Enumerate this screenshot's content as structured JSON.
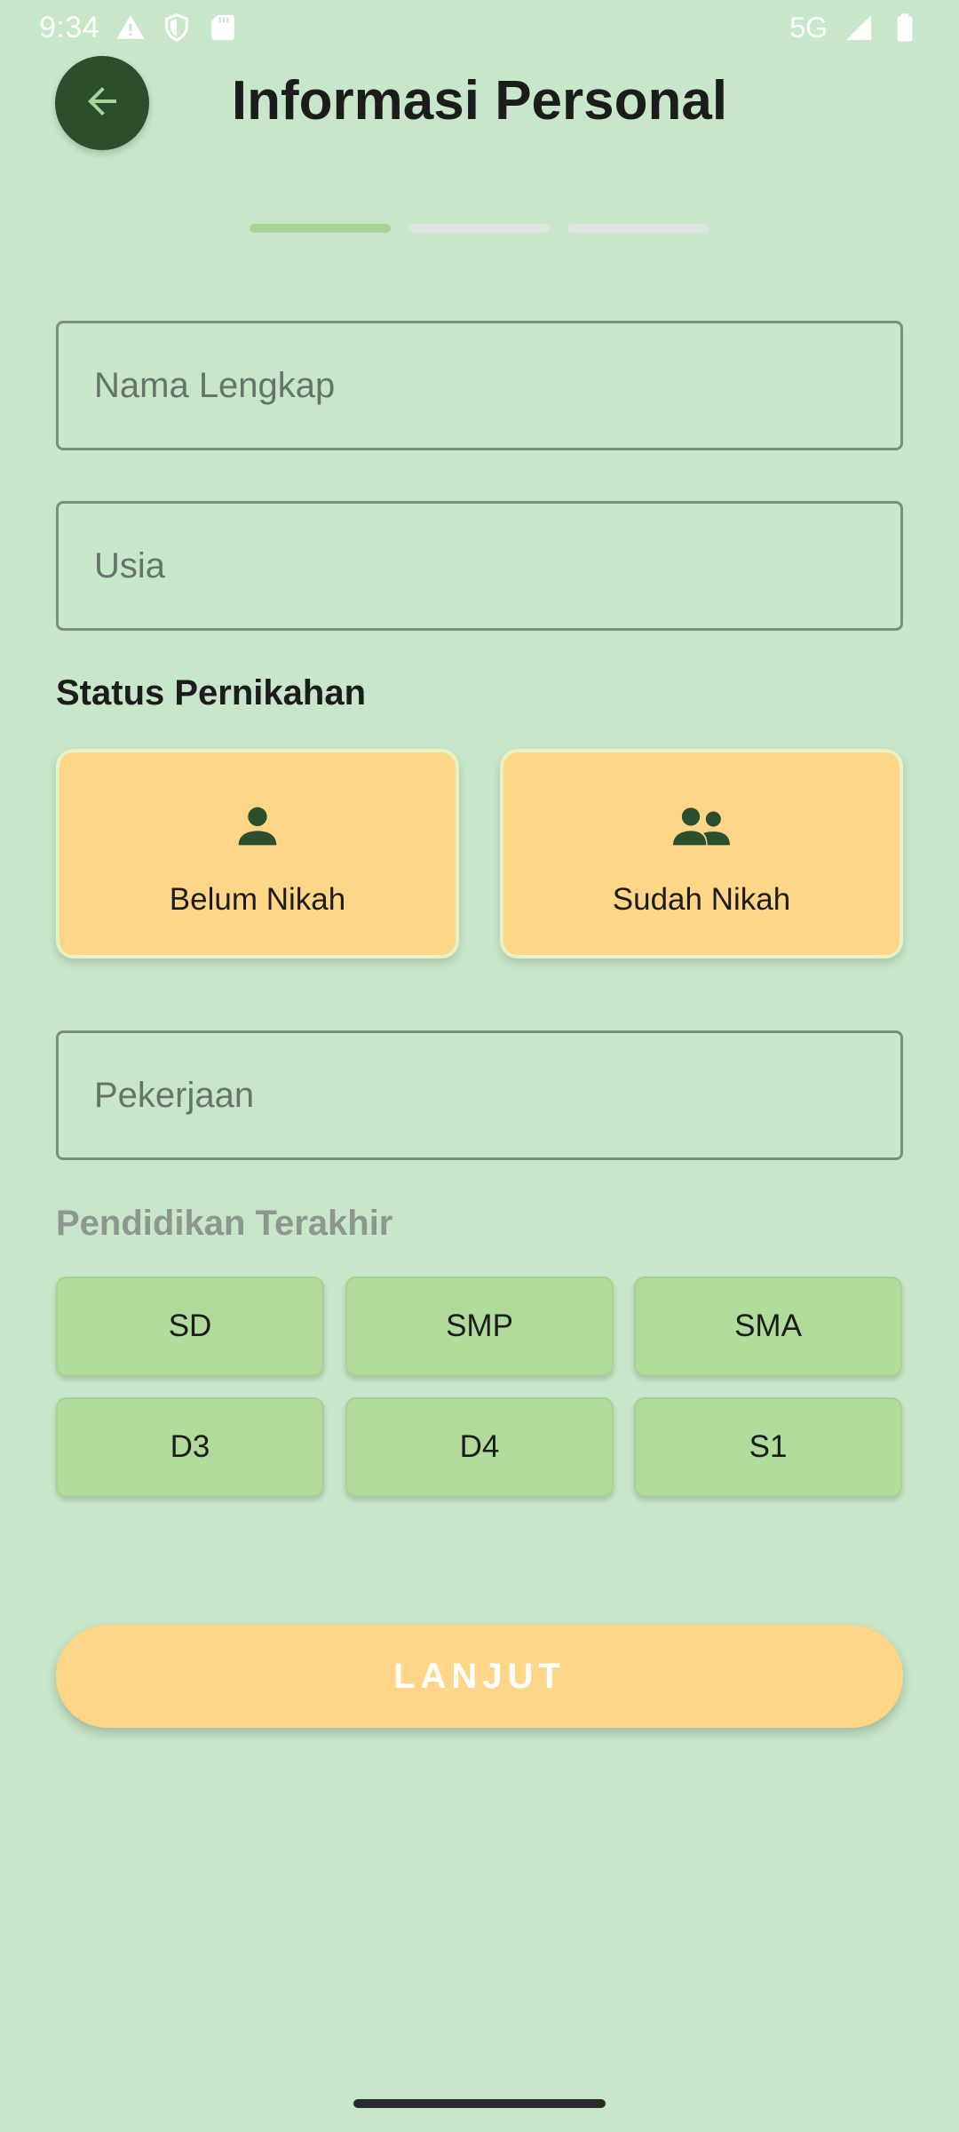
{
  "status_bar": {
    "time": "9:34",
    "network": "5G",
    "icons": [
      "warning-icon",
      "shield-icon",
      "sd-card-icon",
      "signal-icon",
      "battery-icon"
    ]
  },
  "header": {
    "title": "Informasi Personal",
    "back_icon": "arrow-left-icon"
  },
  "progress": {
    "total_steps": 3,
    "current_step": 1,
    "active_color": "#a6d697",
    "inactive_color": "#dde4e2"
  },
  "form": {
    "full_name": {
      "placeholder": "Nama Lengkap",
      "value": ""
    },
    "age": {
      "placeholder": "Usia",
      "value": ""
    },
    "marital_status": {
      "label": "Status Pernikahan",
      "options": [
        {
          "label": "Belum Nikah",
          "icon": "person-icon"
        },
        {
          "label": "Sudah Nikah",
          "icon": "people-icon"
        }
      ]
    },
    "occupation": {
      "placeholder": "Pekerjaan",
      "value": ""
    },
    "education": {
      "label": "Pendidikan Terakhir",
      "options": [
        "SD",
        "SMP",
        "SMA",
        "D3",
        "D4",
        "S1"
      ]
    }
  },
  "actions": {
    "continue_label": "LANJUT"
  },
  "colors": {
    "background": "#c8e6c9",
    "accent_dark": "#2b4f2c",
    "card": "#ffd587",
    "chip": "#b0db9b"
  }
}
